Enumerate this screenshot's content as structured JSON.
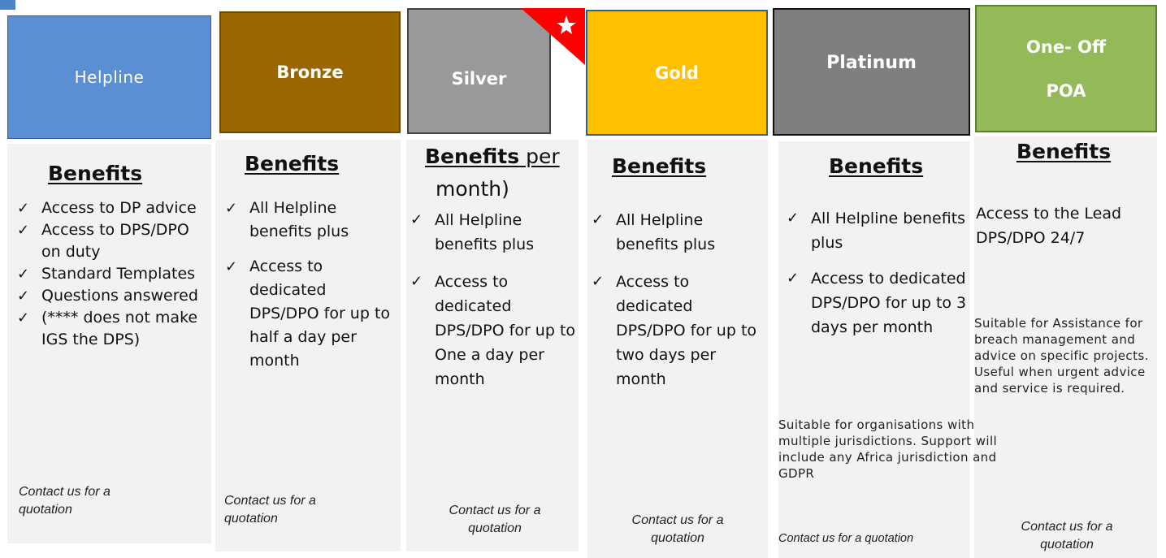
{
  "plans": [
    {
      "name": "Helpline",
      "heading": "Benefits",
      "benefits": [
        "Access to DP advice",
        "Access to DPS/DPO on duty",
        "Standard Templates",
        "Questions answered",
        "(**** does not make IGS the DPS)"
      ],
      "contact": "Contact us for a quotation"
    },
    {
      "name": "Bronze",
      "heading": "Benefits",
      "benefits": [
        "All Helpline benefits plus",
        "Access to dedicated DPS/DPO for up to half a day per month"
      ],
      "contact": "Contact us for a quotation"
    },
    {
      "name": "Silver",
      "heading": "Benefits",
      "heading_suffix": " per",
      "heading_overlap": "month)",
      "benefits": [
        "All Helpline benefits plus",
        "Access to dedicated DPS/DPO for up to One a day per month"
      ],
      "contact": "Contact us for a quotation"
    },
    {
      "name": "Gold",
      "heading": "Benefits",
      "benefits": [
        "All Helpline benefits plus",
        "Access to dedicated DPS/DPO for up to two days per month"
      ],
      "contact": "Contact us for a quotation"
    },
    {
      "name": "Platinum",
      "heading": "Benefits",
      "benefits": [
        "All Helpline benefits plus",
        "Access to dedicated DPS/DPO for up to 3 days per month"
      ],
      "note": "Suitable for organisations with multiple jurisdictions. Support will include any Africa jurisdiction and GDPR",
      "contact": "Contact us for a quotation"
    },
    {
      "name_line1": "One- Off",
      "name_line2": "POA",
      "heading": "Benefits",
      "description": "Access to the Lead DPS/DPO 24/7",
      "note": "Suitable for Assistance for breach management and advice on specific projects. Useful when urgent advice and service is required.",
      "contact": "Contact us for a quotation"
    }
  ],
  "badge_icon": "star-icon",
  "colors": {
    "helpline": "#5b8fd3",
    "bronze": "#996600",
    "silver": "#999999",
    "gold": "#ffc000",
    "platinum": "#7f7f7f",
    "oneoff": "#93b959",
    "badge": "#ff0000"
  }
}
